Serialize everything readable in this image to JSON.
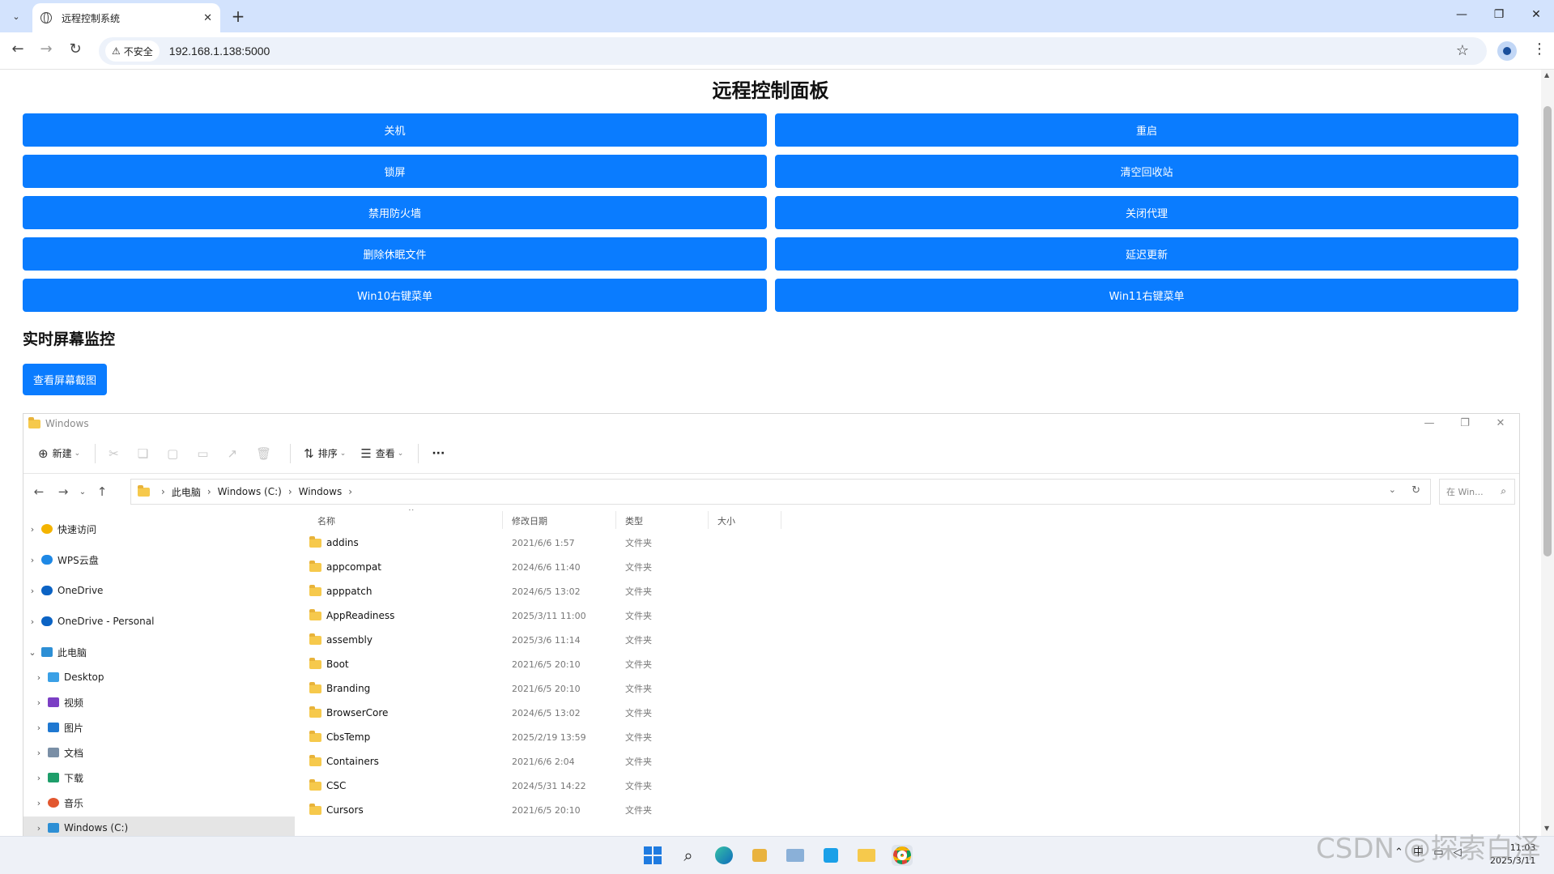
{
  "browser": {
    "tab_title": "远程控制系统",
    "security_label": "不安全",
    "url": "192.168.1.138:5000"
  },
  "page": {
    "title": "远程控制面板",
    "buttons": [
      "关机",
      "重启",
      "锁屏",
      "清空回收站",
      "禁用防火墙",
      "关闭代理",
      "删除休眠文件",
      "延迟更新",
      "Win10右键菜单",
      "Win11右键菜单"
    ],
    "monitor_title": "实时屏幕监控",
    "screenshot_button": "查看屏幕截图"
  },
  "explorer": {
    "window_title": "Windows",
    "commands": {
      "new": "新建",
      "sort": "排序",
      "view": "查看",
      "more": "···"
    },
    "breadcrumb": [
      "此电脑",
      "Windows (C:)",
      "Windows"
    ],
    "search_placeholder": "在 Win...",
    "nav_items": [
      {
        "label": "快速访问",
        "icon": "star-icon",
        "color": "#f4b400"
      },
      {
        "label": "WPS云盘",
        "icon": "cloud-icon",
        "color": "#1e88e5"
      },
      {
        "label": "OneDrive",
        "icon": "cloud-icon",
        "color": "#0b63c4"
      },
      {
        "label": "OneDrive - Personal",
        "icon": "cloud-icon",
        "color": "#0b63c4"
      },
      {
        "label": "此电脑",
        "icon": "computer-icon",
        "color": "#2d8fd5"
      },
      {
        "label": "Desktop",
        "icon": "desktop-icon",
        "color": "#3aa0e6"
      },
      {
        "label": "视频",
        "icon": "video-icon",
        "color": "#7b3fc4"
      },
      {
        "label": "图片",
        "icon": "picture-icon",
        "color": "#1f78d1"
      },
      {
        "label": "文档",
        "icon": "document-icon",
        "color": "#7a8fa6"
      },
      {
        "label": "下载",
        "icon": "download-icon",
        "color": "#1e9e6a"
      },
      {
        "label": "音乐",
        "icon": "music-icon",
        "color": "#e2572f"
      },
      {
        "label": "Windows (C:)",
        "icon": "drive-icon",
        "color": "#2d8fd5"
      }
    ],
    "columns": {
      "name": "名称",
      "modified": "修改日期",
      "type": "类型",
      "size": "大小"
    },
    "files": [
      {
        "name": "addins",
        "date": "2021/6/6 1:57",
        "type": "文件夹"
      },
      {
        "name": "appcompat",
        "date": "2024/6/6 11:40",
        "type": "文件夹"
      },
      {
        "name": "apppatch",
        "date": "2024/6/5 13:02",
        "type": "文件夹"
      },
      {
        "name": "AppReadiness",
        "date": "2025/3/11 11:00",
        "type": "文件夹"
      },
      {
        "name": "assembly",
        "date": "2025/3/6 11:14",
        "type": "文件夹"
      },
      {
        "name": "Boot",
        "date": "2021/6/5 20:10",
        "type": "文件夹"
      },
      {
        "name": "Branding",
        "date": "2021/6/5 20:10",
        "type": "文件夹"
      },
      {
        "name": "BrowserCore",
        "date": "2024/6/5 13:02",
        "type": "文件夹"
      },
      {
        "name": "CbsTemp",
        "date": "2025/2/19 13:59",
        "type": "文件夹"
      },
      {
        "name": "Containers",
        "date": "2021/6/6 2:04",
        "type": "文件夹"
      },
      {
        "name": "CSC",
        "date": "2024/5/31 14:22",
        "type": "文件夹"
      },
      {
        "name": "Cursors",
        "date": "2021/6/5 20:10",
        "type": "文件夹"
      }
    ]
  },
  "taskbar": {
    "tray_ime": "中",
    "clock_time": "11:03",
    "clock_date": "2025/3/11"
  },
  "watermark": "CSDN @探索白泽"
}
